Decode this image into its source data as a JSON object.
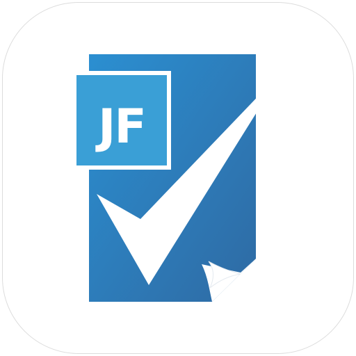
{
  "app_icon": {
    "badge_text": "JF",
    "colors": {
      "document_light": "#2b8fd1",
      "document_dark": "#2f6aa3",
      "badge_fill": "#3a9fd6",
      "badge_border": "#ffffff",
      "checkmark": "#ffffff",
      "tile_background": "#ffffff",
      "tile_border": "#dcdcdc"
    },
    "icons": [
      "document-icon",
      "checkmark-icon",
      "page-curl-icon",
      "jf-badge"
    ]
  }
}
